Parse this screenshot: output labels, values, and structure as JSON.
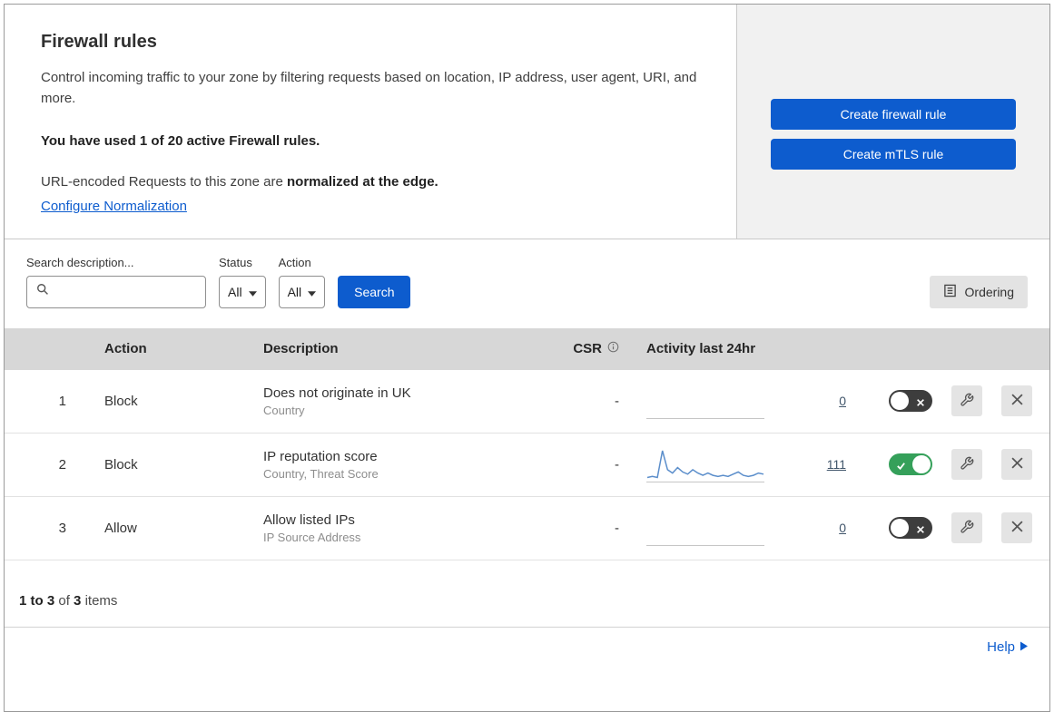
{
  "colors": {
    "accent": "#0d5cce",
    "link": "#0d5cce",
    "toggle_on": "#35a05a",
    "spark": "#5b8ecb"
  },
  "header": {
    "title": "Firewall rules",
    "description": "Control incoming traffic to your zone by filtering requests based on location, IP address, user agent, URI, and more.",
    "usage_bold": "You have used 1 of 20 active Firewall rules.",
    "normalization_prefix": "URL-encoded Requests to this zone are ",
    "normalization_bold": "normalized at the edge.",
    "normalization_link": "Configure Normalization",
    "buttons": {
      "create_firewall_rule": "Create firewall rule",
      "create_mtls_rule": "Create mTLS rule"
    }
  },
  "filters": {
    "search_label": "Search description...",
    "search_value": "",
    "status_label": "Status",
    "status_value": "All",
    "action_label": "Action",
    "action_value": "All",
    "search_button": "Search",
    "ordering_button": "Ordering"
  },
  "table": {
    "columns": {
      "action": "Action",
      "description": "Description",
      "csr": "CSR",
      "activity": "Activity last 24hr"
    },
    "rows": [
      {
        "num": "1",
        "action": "Block",
        "description": "Does not originate in UK",
        "fields": "Country",
        "csr": "-",
        "count": "0",
        "enabled": false,
        "sparkline": []
      },
      {
        "num": "2",
        "action": "Block",
        "description": "IP reputation score",
        "fields": "Country, Threat Score",
        "csr": "-",
        "count": "111",
        "enabled": true,
        "sparkline": [
          2,
          3,
          2,
          26,
          9,
          6,
          11,
          7,
          5,
          9,
          6,
          4,
          6,
          4,
          3,
          4,
          3,
          5,
          7,
          4,
          3,
          4,
          6,
          5
        ]
      },
      {
        "num": "3",
        "action": "Allow",
        "description": "Allow listed IPs",
        "fields": "IP Source Address",
        "csr": "-",
        "count": "0",
        "enabled": false,
        "sparkline": []
      }
    ]
  },
  "footer": {
    "range_bold": "1 to 3",
    "of_text": "of",
    "total_bold": "3",
    "items_text": "items"
  },
  "help": {
    "label": "Help"
  }
}
